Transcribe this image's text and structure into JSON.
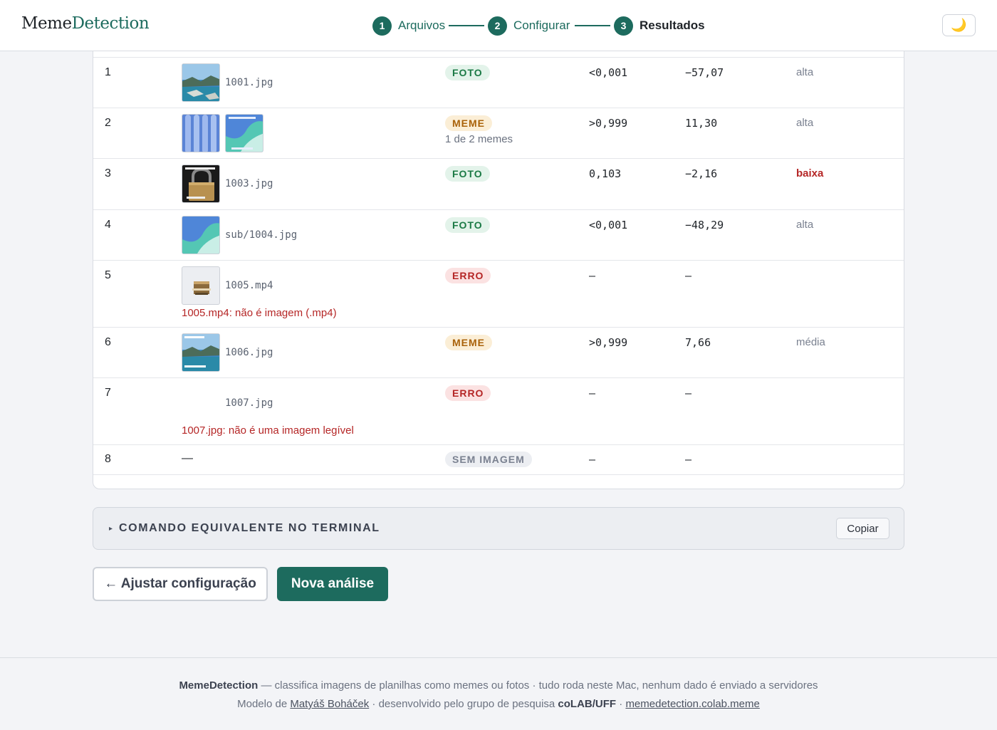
{
  "brand": {
    "part1": "Meme",
    "part2": "Detection"
  },
  "steps": [
    {
      "num": "1",
      "label": "Arquivos"
    },
    {
      "num": "2",
      "label": "Configurar"
    },
    {
      "num": "3",
      "label": "Resultados"
    }
  ],
  "theme_toggle": {
    "icon": "🌙"
  },
  "rows": [
    {
      "index": "1",
      "file": "1001.jpg",
      "badge": "FOTO",
      "p": "<0,001",
      "score": "−57,07",
      "conf": "alta"
    },
    {
      "index": "2",
      "file": "",
      "badge": "MEME",
      "note": "1 de 2 memes",
      "p": ">0,999",
      "score": "11,30",
      "conf": "alta"
    },
    {
      "index": "3",
      "file": "1003.jpg",
      "badge": "FOTO",
      "p": "0,103",
      "score": "−2,16",
      "conf": "baixa"
    },
    {
      "index": "4",
      "file": "sub/1004.jpg",
      "badge": "FOTO",
      "p": "<0,001",
      "score": "−48,29",
      "conf": "alta"
    },
    {
      "index": "5",
      "file": "1005.mp4",
      "badge": "ERRO",
      "p": "—",
      "score": "—",
      "conf": "",
      "error": "1005.mp4: não é imagem (.mp4)"
    },
    {
      "index": "6",
      "file": "1006.jpg",
      "badge": "MEME",
      "p": ">0,999",
      "score": "7,66",
      "conf": "média"
    },
    {
      "index": "7",
      "file": "1007.jpg",
      "badge": "ERRO",
      "p": "—",
      "score": "—",
      "conf": "",
      "error": "1007.jpg: não é uma imagem legível"
    },
    {
      "index": "8",
      "file": "—",
      "badge": "SEM IMAGEM",
      "p": "—",
      "score": "—",
      "conf": ""
    }
  ],
  "terminal": {
    "title": "COMANDO EQUIVALENTE NO TERMINAL",
    "copy": "Copiar"
  },
  "actions": {
    "back": "← Ajustar configuração",
    "new": "Nova análise"
  },
  "footer": {
    "brand": "MemeDetection",
    "line1_rest": " — classifica imagens de planilhas como memes ou fotos · tudo roda neste Mac, nenhum dado é enviado a servidores",
    "line2_a": "Modelo de ",
    "author": "Matyáš Boháček",
    "line2_b": " · desenvolvido pelo grupo de pesquisa ",
    "group": "coLAB/UFF",
    "line2_c": " · ",
    "link": "memedetection.colab.meme"
  },
  "colors": {
    "accent": "#1d6b5e",
    "foto": "#1b7a45",
    "meme": "#a9620a",
    "erro": "#b52626",
    "sem": "#7a8190"
  }
}
